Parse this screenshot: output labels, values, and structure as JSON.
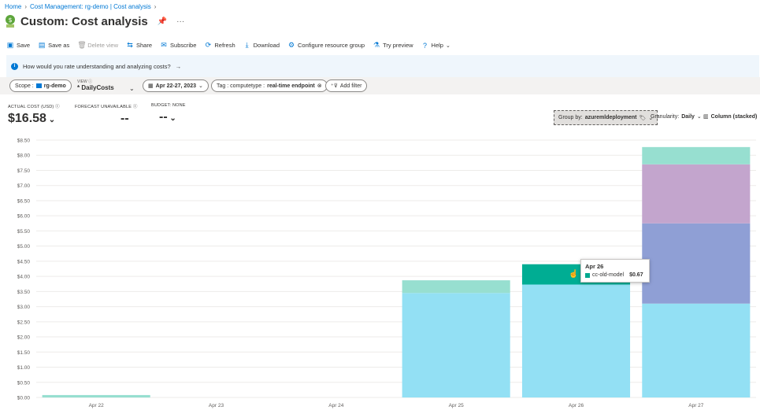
{
  "breadcrumb": {
    "items": [
      "Home",
      "Cost Management: rg-demo | Cost analysis"
    ]
  },
  "header": {
    "title": "Custom: Cost analysis",
    "pin_icon": "pin-icon",
    "more": "···"
  },
  "toolbar": {
    "save": "Save",
    "save_as": "Save as",
    "delete_view": "Delete view",
    "share": "Share",
    "subscribe": "Subscribe",
    "refresh": "Refresh",
    "download": "Download",
    "configure": "Configure resource group",
    "try_preview": "Try preview",
    "help": "Help"
  },
  "banner": {
    "text": "How would you rate understanding and analyzing costs?",
    "arrow": "→"
  },
  "filters": {
    "scope_label": "Scope :",
    "scope_value": "rg-demo",
    "view_label": "VIEW",
    "view_value": "* DailyCosts",
    "date_value": "Apr 22-27, 2023",
    "tag_label": "Tag : computetype :",
    "tag_value": "real-time endpoint",
    "add_filter": "Add filter"
  },
  "kpis": {
    "actual_label": "ACTUAL COST (USD)",
    "actual_value": "$16.58",
    "forecast_label": "FORECAST UNAVAILABLE",
    "forecast_value": "--",
    "budget_label": "BUDGET: NONE",
    "budget_value": "--"
  },
  "controls": {
    "group_by_label": "Group by:",
    "group_by_value": "azuremldeployment",
    "granularity_label": "Granularity:",
    "granularity_value": "Daily",
    "chart_type_value": "Column (stacked)"
  },
  "tooltip": {
    "date": "Apr 26",
    "series": "cc-old-model",
    "value": "$0.67"
  },
  "colors": {
    "accent": "#0078d4"
  },
  "chart_data": {
    "type": "bar",
    "stacked": true,
    "categories": [
      "Apr 22",
      "Apr 23",
      "Apr 24",
      "Apr 25",
      "Apr 26",
      "Apr 27"
    ],
    "series": [
      {
        "color": "#93e0f4",
        "values": [
          0.0,
          0,
          0,
          3.45,
          3.73,
          3.1
        ]
      },
      {
        "color": "#8f9fd5",
        "values": [
          0,
          0,
          0,
          0,
          0,
          2.65
        ]
      },
      {
        "color": "#c3a5cd",
        "values": [
          0,
          0,
          0,
          0,
          0,
          1.95
        ]
      },
      {
        "name": "cc-old-model",
        "color": "#00ad93",
        "values": [
          0,
          0,
          0,
          0,
          0.67,
          0
        ]
      },
      {
        "color": "#97dfd0",
        "values": [
          0.08,
          0,
          0,
          0.42,
          0,
          0.57
        ]
      }
    ],
    "y_ticks": [
      "$0.00",
      "$0.50",
      "$1.00",
      "$1.50",
      "$2.00",
      "$2.50",
      "$3.00",
      "$3.50",
      "$4.00",
      "$4.50",
      "$5.00",
      "$5.50",
      "$6.00",
      "$6.50",
      "$7.00",
      "$7.50",
      "$8.00",
      "$8.50"
    ],
    "ylim": [
      0,
      8.5
    ],
    "grid": true
  }
}
